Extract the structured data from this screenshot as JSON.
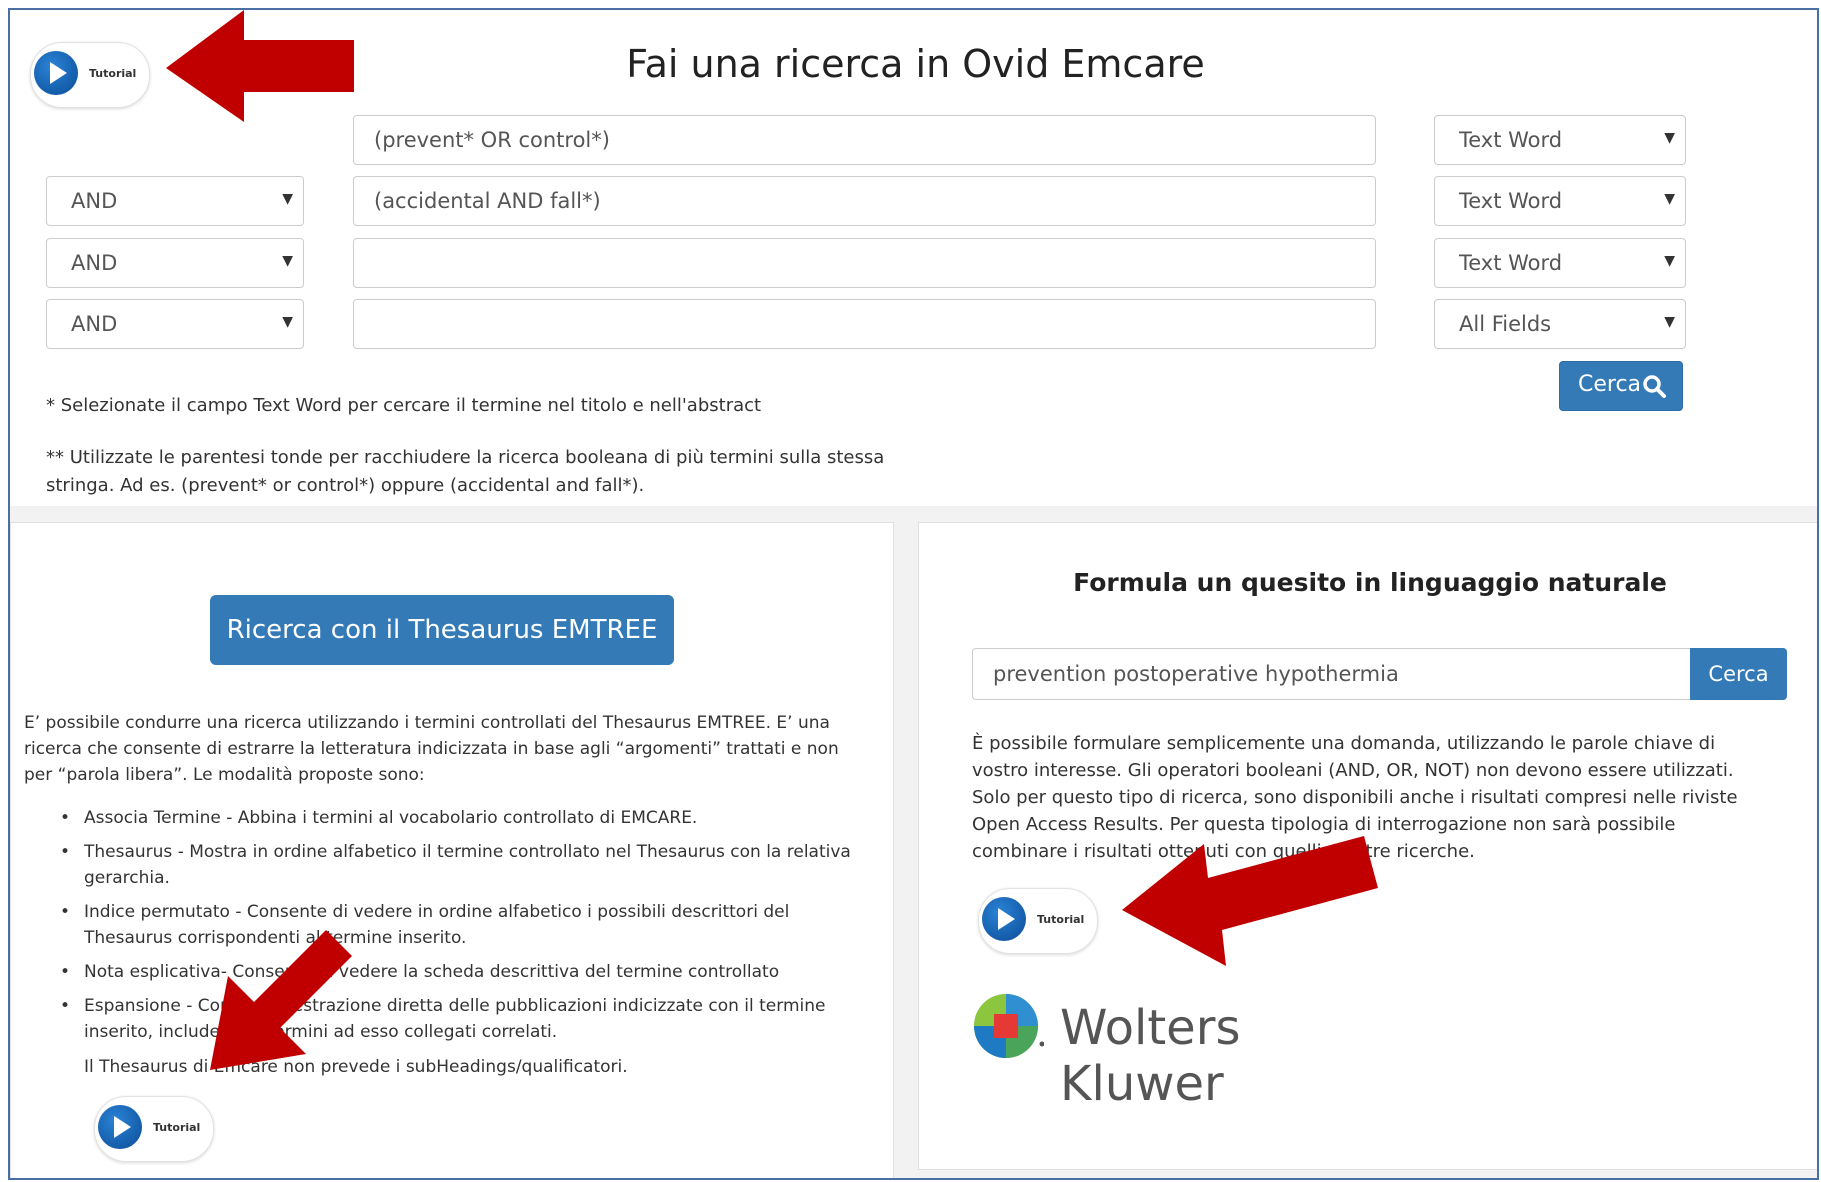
{
  "header": {
    "title": "Fai una ricerca in Ovid Emcare"
  },
  "tutorial": {
    "label": "Tutorial"
  },
  "search_rows": [
    {
      "operator": "",
      "term": "(prevent* OR control*)",
      "field": "Text Word"
    },
    {
      "operator": "AND",
      "term": "(accidental AND fall*)",
      "field": "Text Word"
    },
    {
      "operator": "AND",
      "term": "",
      "field": "Text Word"
    },
    {
      "operator": "AND",
      "term": "",
      "field": "All Fields"
    }
  ],
  "top_search": {
    "button_label": "Cerca"
  },
  "notes": {
    "note1": "* Selezionate il campo Text Word per cercare il termine nel titolo e nell'abstract",
    "note2_line1": "** Utilizzate le parentesi tonde per racchiudere la ricerca booleana di più termini sulla stessa",
    "note2_line2": "stringa. Ad es. (prevent* or control*) oppure (accidental and fall*)."
  },
  "thesaurus": {
    "button_label": "Ricerca con il Thesaurus EMTREE",
    "intro_line1": "E’ possibile condurre una ricerca utilizzando i termini controllati del Thesaurus EMTREE. E’ una",
    "intro_line2": "ricerca che consente di estrarre la letteratura indicizzata in base agli “argomenti” trattati e non",
    "intro_line3": "per “parola libera”. Le modalità proposte sono:",
    "items": [
      {
        "line1": "Associa Termine - Abbina i termini al vocabolario controllato di EMCARE.",
        "line2": ""
      },
      {
        "line1": "Thesaurus - Mostra in ordine alfabetico il termine controllato nel Thesaurus con la relativa",
        "line2": "gerarchia."
      },
      {
        "line1": "Indice permutato - Consente di vedere in ordine alfabetico i possibili descrittori del",
        "line2": "Thesaurus corrispondenti al termine inserito."
      },
      {
        "line1": "Nota esplicativa- Consente di vedere la scheda descrittiva del termine controllato",
        "line2": ""
      },
      {
        "line1": "Espansione - Consente l'estrazione diretta delle pubblicazioni indicizzate con il termine",
        "line2": "inserito, includendo i termini ad esso collegati correlati."
      }
    ],
    "footer": "Il Thesaurus di Emcare non prevede i subHeadings/qualificatori."
  },
  "natural_language": {
    "title": "Formula un quesito in linguaggio naturale",
    "input_value": "prevention postoperative hypothermia",
    "button_label": "Cerca",
    "desc_line1": "È possibile formulare semplicemente una domanda, utilizzando le parole chiave di",
    "desc_line2": "vostro interesse. Gli operatori booleani (AND, OR, NOT) non devono essere utilizzati.",
    "desc_line3": "Solo per questo tipo di ricerca, sono disponibili anche i risultati compresi nelle riviste",
    "desc_line4": "Open Access Results. Per questa tipologia di interrogazione non sarà possibile",
    "desc_line5": "combinare i risultati ottenuti con quelli di altre ricerche."
  },
  "brand": {
    "name": "Wolters Kluwer"
  },
  "colors": {
    "primary": "#337ab7",
    "arrow": "#c00000",
    "frame": "#4a6fa5"
  },
  "icons": {
    "play": "play-icon",
    "search": "magnifier-icon",
    "caret": "caret-down-icon",
    "logo": "wolters-kluwer-logo"
  }
}
